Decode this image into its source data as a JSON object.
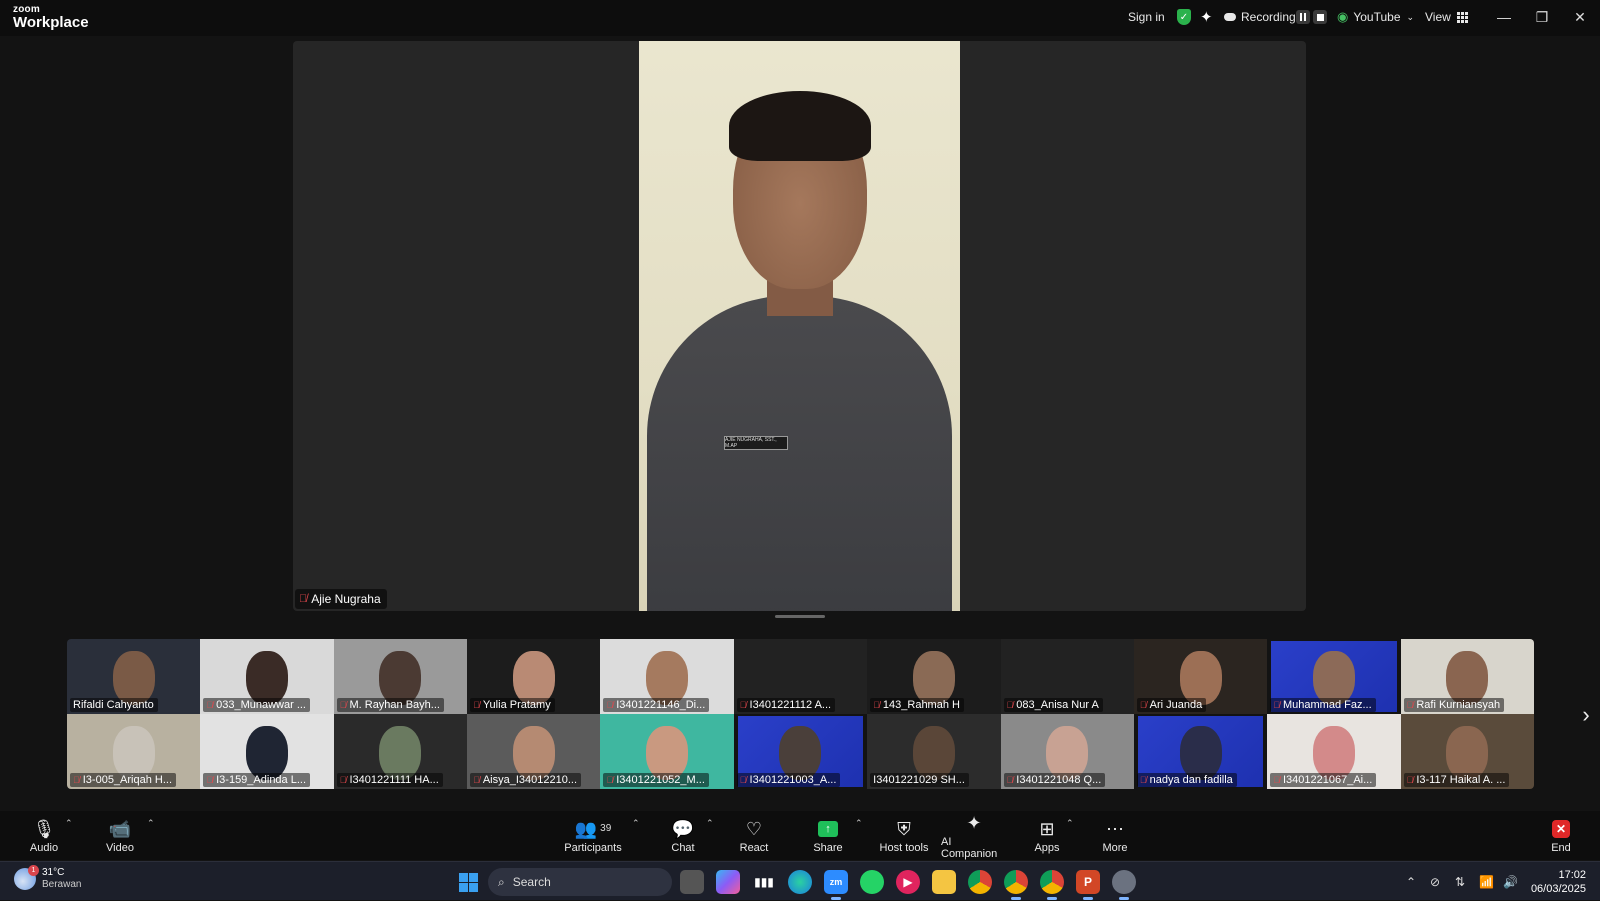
{
  "app": {
    "logo_top": "zoom",
    "logo_bottom": "Workplace"
  },
  "topbar": {
    "sign_in": "Sign in",
    "recording": "Recording...",
    "stream_target": "YouTube",
    "view": "View"
  },
  "speaker": {
    "name": "Ajie Nugraha",
    "name_tag": "AJIE NUGRAHA, SST., M.AP"
  },
  "gallery": {
    "row1": [
      {
        "name": "Rifaldi Cahyanto",
        "muted": false,
        "bg": "#2a2f3a",
        "face": "#7a5a46"
      },
      {
        "name": "033_Munawwar ...",
        "muted": true,
        "bg": "#d9d9d9",
        "face": "#3a2b26"
      },
      {
        "name": "M. Rayhan Bayh...",
        "muted": true,
        "bg": "#9a9a9a",
        "face": "#4b3a33"
      },
      {
        "name": "Yulia Pratamy",
        "muted": true,
        "bg": "#1c1c1c",
        "face": "#b98a74"
      },
      {
        "name": "I3401221146_Di...",
        "muted": true,
        "bg": "#dcdcdc",
        "face": "#a57a5f"
      },
      {
        "name": "I3401221112 A...",
        "muted": true,
        "bg": "#222222",
        "face": ""
      },
      {
        "name": "143_Rahmah H",
        "muted": true,
        "bg": "#1c1c1c",
        "face": "#8a6a55"
      },
      {
        "name": "083_Anisa Nur A",
        "muted": true,
        "bg": "#222222",
        "face": ""
      },
      {
        "name": "Ari Juanda",
        "muted": true,
        "bg": "#2b2520",
        "face": "#9c6f55"
      },
      {
        "name": "Muhammad Faz...",
        "muted": true,
        "bg": "blue",
        "face": "#8c6a58"
      },
      {
        "name": "Rafi Kurniansyah",
        "muted": true,
        "bg": "#d8d5cc",
        "face": "#8a6550"
      }
    ],
    "row2": [
      {
        "name": "I3-005_Ariqah H...",
        "muted": true,
        "bg": "#b8b1a0",
        "face": "#c8c2b8"
      },
      {
        "name": "I3-159_Adinda L...",
        "muted": true,
        "bg": "#e2e2e2",
        "face": "#1f2533"
      },
      {
        "name": "I3401221111 HA...",
        "muted": true,
        "bg": "#2a2a2a",
        "face": "#6a7a60"
      },
      {
        "name": "Aisya_I34012210...",
        "muted": true,
        "bg": "#5b5b5b",
        "face": "#b58a72"
      },
      {
        "name": "I3401221052_M...",
        "muted": true,
        "bg": "#3fb7a0",
        "face": "#c99980"
      },
      {
        "name": "I3401221003_A...",
        "muted": true,
        "bg": "blue",
        "face": "#4a3f3a"
      },
      {
        "name": "I3401221029 SH...",
        "muted": false,
        "bg": "#2c2c2c",
        "face": "#5a4638"
      },
      {
        "name": "I3401221048 Q...",
        "muted": true,
        "bg": "#8a8a8a",
        "face": "#c8a293"
      },
      {
        "name": "nadya dan fadilla",
        "muted": true,
        "bg": "blue",
        "face": "#2a2d4a"
      },
      {
        "name": "I3401221067_Ai...",
        "muted": true,
        "bg": "#e8e4e0",
        "face": "#d38a8a"
      },
      {
        "name": "I3-117 Haikal A. ...",
        "muted": true,
        "bg": "#5a4b3b",
        "face": "#8a6650"
      }
    ]
  },
  "toolbar": {
    "audio": "Audio",
    "video": "Video",
    "participants": "Participants",
    "participants_count": "39",
    "chat": "Chat",
    "react": "React",
    "share": "Share",
    "host_tools": "Host tools",
    "ai_companion": "AI Companion",
    "apps": "Apps",
    "more": "More",
    "end": "End"
  },
  "taskbar": {
    "temperature": "31°C",
    "weather": "Berawan",
    "search": "Search",
    "time": "17:02",
    "date": "06/03/2025"
  },
  "colors": {
    "accent_green": "#1fbf5a",
    "end_red": "#e02828",
    "muted_red": "#e5484d",
    "active_border": "#4e72e6"
  }
}
